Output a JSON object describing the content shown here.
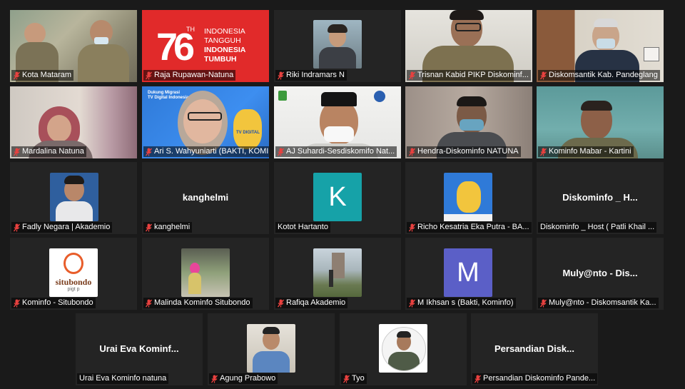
{
  "tiles": [
    {
      "name": "Kota Mataram",
      "muted": true
    },
    {
      "name": "Raja Rupawan-Natuna",
      "muted": true
    },
    {
      "name": "Riki Indramars N",
      "muted": true
    },
    {
      "name": "Trisnan Kabid PIKP Diskominf...",
      "muted": true
    },
    {
      "name": "Diskomsantik Kab. Pandeglang",
      "muted": true
    },
    {
      "name": "Mardalina Natuna",
      "muted": true
    },
    {
      "name": "Ari S. Wahyuniarti (BAKTI, KOMIN...",
      "muted": true
    },
    {
      "name": "AJ Suhardi-Sesdiskomifo Nat...",
      "muted": true
    },
    {
      "name": "Hendra-Diskominfo NATUNA",
      "muted": true
    },
    {
      "name": "Kominfo Mabar - Kartini",
      "muted": true
    },
    {
      "name": "Fadly Negara | Akademio",
      "muted": true
    },
    {
      "name": "kanghelmi",
      "muted": true,
      "bigname": "kanghelmi"
    },
    {
      "name": "Kotot Hartanto",
      "muted": false,
      "letter": "K"
    },
    {
      "name": "Richo Kesatria Eka Putra - BA...",
      "muted": true
    },
    {
      "name": "Diskominfo _ Host  ( Patli Khail ...",
      "muted": false,
      "bigname": "Diskominfo _ H..."
    },
    {
      "name": "Kominfo - Situbondo",
      "muted": true
    },
    {
      "name": "Malinda Kominfo Situbondo",
      "muted": true
    },
    {
      "name": "Rafiqa Akademio",
      "muted": true
    },
    {
      "name": "M Ikhsan s (Bakti, Kominfo)",
      "muted": true,
      "letter": "M"
    },
    {
      "name": "Muly@nto - Diskomsantik Ka...",
      "muted": true,
      "bigname": "Muly@nto - Dis..."
    },
    {
      "name": "Urai Eva Kominfo natuna",
      "muted": false,
      "bigname": "Urai Eva Kominf..."
    },
    {
      "name": "Agung Prabowo",
      "muted": true
    },
    {
      "name": "Tyo",
      "muted": true
    },
    {
      "name": "Persandian Diskominfo Pande...",
      "muted": true,
      "bigname": "Persandian  Disk..."
    }
  ],
  "banner": {
    "th": "TH",
    "line1": "INDONESIA",
    "line2": "TANGGUH",
    "line3": "INDONESIA",
    "line4": "TUMBUH"
  },
  "slide": {
    "line1": "Dukung Migrasi",
    "line2": "TV Digital Indonesia",
    "mascot": "TV DIGITAL"
  },
  "logo_text": {
    "main": "situbondo",
    "sub": "pigt p"
  },
  "colors": {
    "muted_icon": "#e8413f",
    "active_border": "#d9e04a",
    "letter_k": "#16a2a8",
    "letter_m": "#5b5fc7"
  }
}
